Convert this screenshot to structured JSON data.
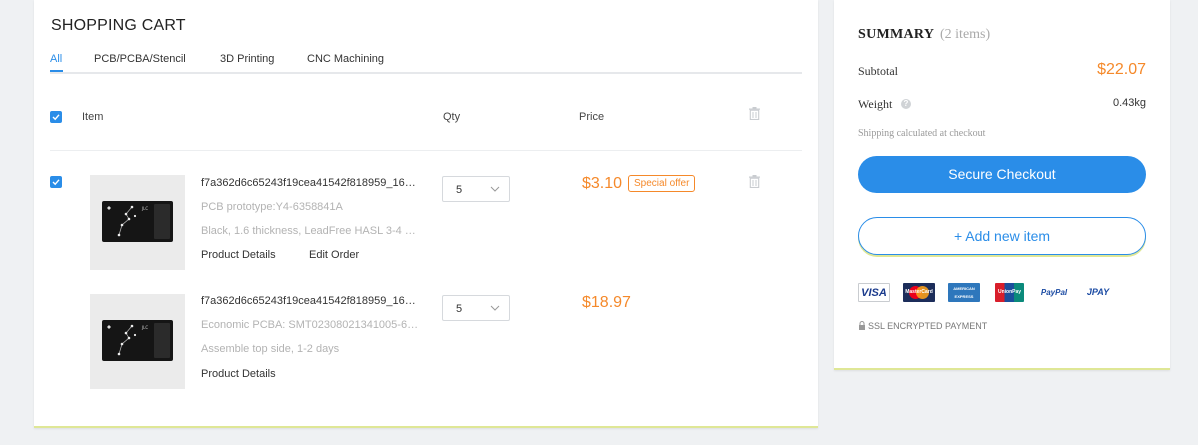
{
  "cart": {
    "title": "SHOPPING CART",
    "tabs": [
      {
        "label": "All",
        "active": true
      },
      {
        "label": "PCB/PCBA/Stencil",
        "active": false
      },
      {
        "label": "3D Printing",
        "active": false
      },
      {
        "label": "CNC Machining",
        "active": false
      }
    ],
    "headers": {
      "item": "Item",
      "qty": "Qty",
      "price": "Price"
    },
    "items": [
      {
        "name": "f7a362d6c65243f19cea41542f818959_16…",
        "line1": "PCB prototype:Y4-6358841A",
        "line2": "Black, 1.6 thickness, LeadFree HASL 3-4 …",
        "links": [
          "Product Details",
          "Edit Order"
        ],
        "qty": "5",
        "price": "$3.10",
        "badge": "Special offer",
        "checked": true
      },
      {
        "name": "f7a362d6c65243f19cea41542f818959_16…",
        "line1": "Economic PCBA: SMT02308021341005-6…",
        "line2": "Assemble top side, 1-2 days",
        "links": [
          "Product Details"
        ],
        "qty": "5",
        "price": "$18.97"
      }
    ]
  },
  "summary": {
    "title": "SUMMARY",
    "count": "(2 items)",
    "subtotal_label": "Subtotal",
    "subtotal_value": "$22.07",
    "weight_label": "Weight",
    "weight_value": "0.43kg",
    "shipping_note": "Shipping calculated at checkout",
    "checkout_label": "Secure Checkout",
    "add_label": "+   Add new item",
    "payment_methods": [
      "VISA",
      "MasterCard",
      "AMERICAN EXPRESS",
      "UnionPay",
      "PayPal",
      "JPAY"
    ],
    "ssl_text": "SSL ENCRYPTED PAYMENT"
  },
  "colors": {
    "accent": "#2a8de8",
    "price": "#f5892a",
    "page_bg": "#eff1f3",
    "underline": "#dfe796"
  },
  "icons": [
    "checkbox-checked-icon",
    "trash-icon",
    "chevron-down-icon",
    "question-icon",
    "lock-icon"
  ]
}
